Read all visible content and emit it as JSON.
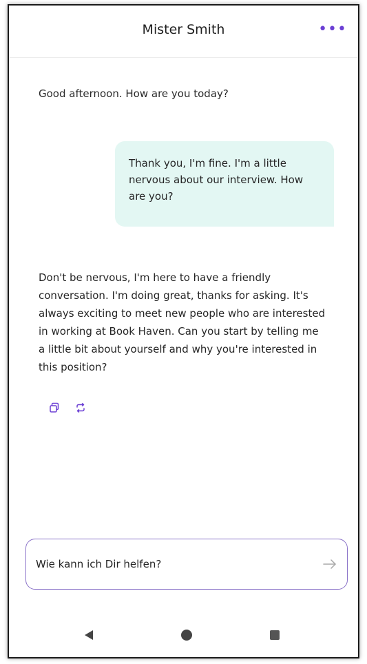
{
  "header": {
    "title": "Mister Smith",
    "menu_label": "•••"
  },
  "messages": [
    {
      "role": "bot",
      "text": "Good afternoon. How are you today?"
    },
    {
      "role": "user",
      "text": "Thank you, I'm fine. I'm a little nervous about our interview. How are you?"
    },
    {
      "role": "bot",
      "text": "Don't be nervous, I'm here to have a friendly conversation. I'm doing great, thanks for asking. It's always exciting to meet new people who are interested in working at Book Haven. Can you start by telling me a little bit about yourself and why you're interested in this position?"
    }
  ],
  "actions": [
    {
      "name": "copy-icon"
    },
    {
      "name": "regenerate-icon"
    }
  ],
  "composer": {
    "placeholder": "Wie kann ich Dir helfen?",
    "value": ""
  },
  "colors": {
    "accent": "#6b3fd4",
    "user_bubble": "#e3f7f3",
    "composer_border": "#8a72c8"
  },
  "navbar": {
    "icons": [
      "back-icon",
      "home-icon",
      "recents-icon"
    ]
  }
}
